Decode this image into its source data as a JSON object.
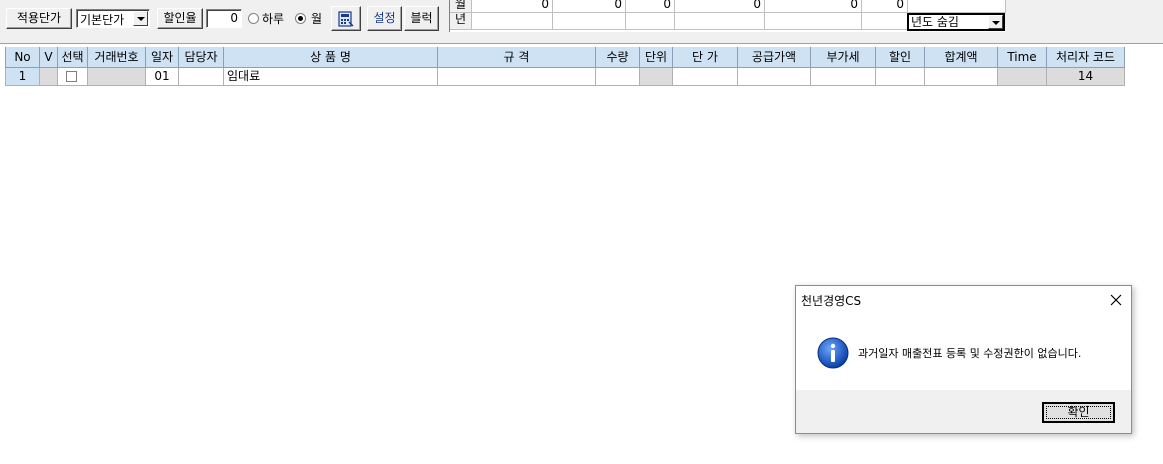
{
  "toolbar": {
    "price_type_label": "적용단가",
    "price_type_value": "기본단가",
    "discount_label": "할인율",
    "discount_value": "0",
    "radio_day_label": "하루",
    "radio_month_label": "월",
    "settings_label": "설정",
    "block_label": "블럭"
  },
  "summary": {
    "row_month_label": "월",
    "row_year_label": "년",
    "month_values": [
      "0",
      "0",
      "0",
      "0",
      "0",
      "0"
    ],
    "year_hide_label": "년도 숨김"
  },
  "grid": {
    "headers": [
      "No",
      "V",
      "선택",
      "거래번호",
      "일자",
      "담당자",
      "상 품 명",
      "규 격",
      "수량",
      "단위",
      "단 가",
      "공급가액",
      "부가세",
      "할인",
      "합계액",
      "Time",
      "처리자 코드"
    ],
    "row": {
      "no": "1",
      "date": "01",
      "product": "임대료",
      "handler_code": "14"
    }
  },
  "dialog": {
    "title": "천년경영CS",
    "message": "과거일자 매출전표 등록 및 수정권한이 없습니다.",
    "ok_label": "확인",
    "icon": "info-icon"
  }
}
